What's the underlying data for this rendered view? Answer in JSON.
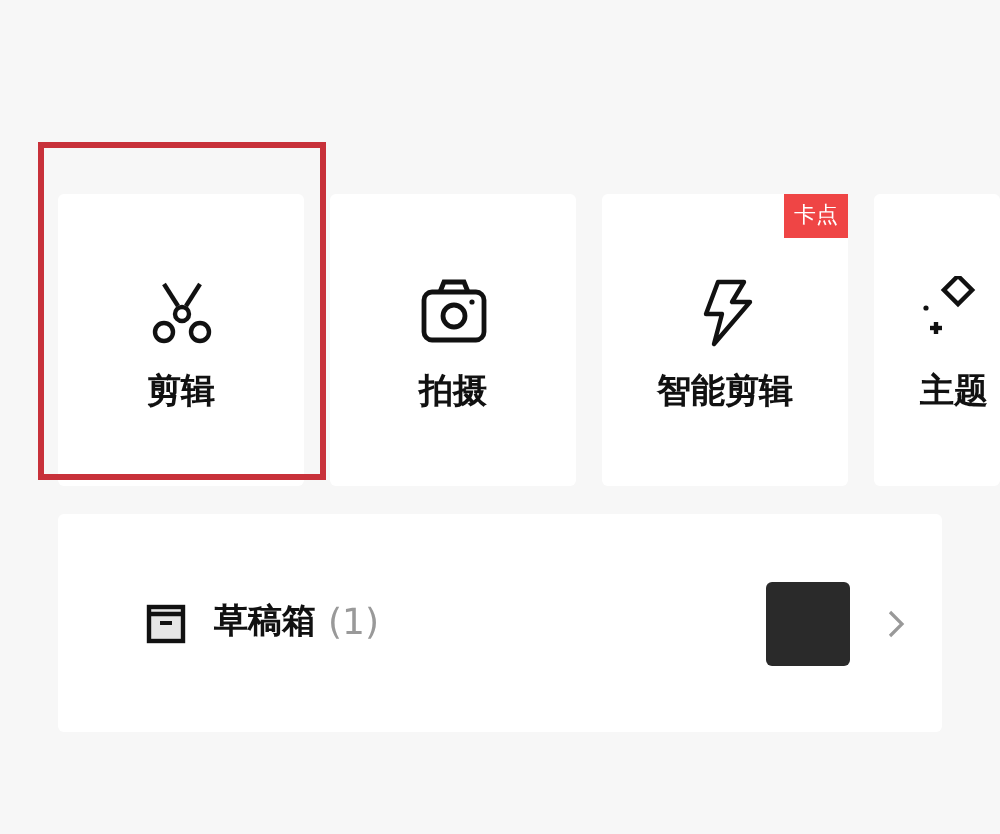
{
  "tiles": [
    {
      "kind": "scissors",
      "label": "剪辑",
      "highlighted": true
    },
    {
      "kind": "camera",
      "label": "拍摄",
      "highlighted": false
    },
    {
      "kind": "lightning",
      "label": "智能剪辑",
      "highlighted": false,
      "badge": "卡点"
    },
    {
      "kind": "wand",
      "label": "主题",
      "highlighted": false
    }
  ],
  "drafts": {
    "label": "草稿箱",
    "count": "(1)"
  }
}
